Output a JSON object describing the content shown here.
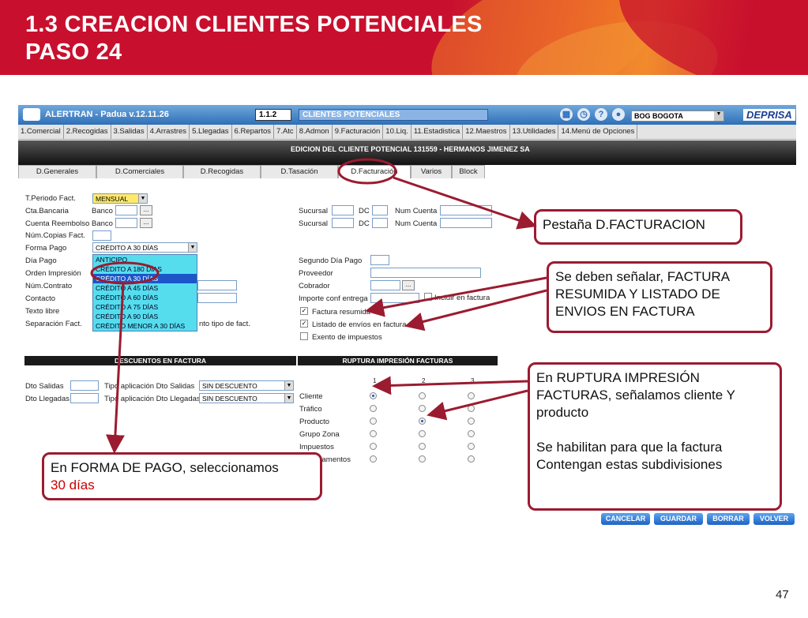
{
  "slide": {
    "title_line1": "1.3 CREACION CLIENTES POTENCIALES",
    "title_line2": "PASO 24",
    "page_number": "47"
  },
  "app": {
    "name": "ALERTRAN - Padua  v.12.11.26",
    "code": "1.1.2",
    "module": "CLIENTES POTENCIALES",
    "city": "BOG BOGOTA",
    "brand": "DEPRISA",
    "menu": [
      "1.Comercial",
      "2.Recogidas",
      "3.Salidas",
      "4.Arrastres",
      "5.Llegadas",
      "6.Repartos",
      "7.Atc",
      "8.Admon",
      "9.Facturación",
      "10.Liq.",
      "11.Estadistica",
      "12.Maestros",
      "13.Utilidades",
      "14.Menú de Opciones"
    ],
    "edit_title": "EDICION DEL CLIENTE POTENCIAL 131559 - HERMANOS JIMENEZ SA",
    "tabs": [
      "D.Generales",
      "D.Comerciales",
      "D.Recogidas",
      "D.Tasación",
      "D.Facturación",
      "Varios",
      "Block"
    ]
  },
  "form": {
    "periodo_label": "T.Periodo Fact.",
    "periodo_value": "MENSUAL",
    "cta_bancaria_label": "Cta.Bancaria",
    "cuenta_reembolso_label": "Cuenta Reembolso",
    "banco_label": "Banco",
    "copias_label": "Núm.Copias Fact.",
    "forma_pago_label": "Forma Pago",
    "forma_pago_value": "CRÉDITO A 30 DÍAS",
    "forma_pago_options": [
      "ANTICIPO",
      "CRÉDITO A 180 DÍAS",
      "CRÉDITO A 30 DÍAS",
      "CRÉDITO A 45 DÍAS",
      "CRÉDITO A 60 DÍAS",
      "CRÉDITO A 75 DÍAS",
      "CRÉDITO A 90 DÍAS",
      "CRÉDITO MENOR A 30 DÍAS"
    ],
    "dia_pago_label": "Día Pago",
    "orden_impresion_label": "Orden Impresión",
    "num_contrato_label": "Núm.Contrato",
    "contacto_label": "Contacto",
    "texto_libre_label": "Texto libre",
    "separacion_label": "Separación Fact.",
    "separacion_tail": "nto tipo de fact.",
    "sucursal_label": "Sucursal",
    "dc_label": "DC",
    "num_cuenta_label": "Num Cuenta",
    "segundo_dia_label": "Segundo Día Pago",
    "proveedor_label": "Proveedor",
    "cobrador_label": "Cobrador",
    "importe_label": "Importe conf entrega",
    "incluir_label": "Incluir en factura",
    "factura_resumida_label": "Factura resumida",
    "listado_envios_label": "Listado de envíos en factura",
    "exento_label": "Exento de impuestos",
    "descuentos_title": "DESCUENTOS EN FACTURA",
    "ruptura_title": "RUPTURA IMPRESIÓN FACTURAS",
    "dto_salidas_label": "Dto Salidas",
    "dto_llegadas_label": "Dto Llegadas",
    "tipo_salidas_label": "Tipo aplicación Dto Salidas",
    "tipo_llegadas_label": "Tipo aplicación Dto Llegadas",
    "sin_descuento": "SIN DESCUENTO",
    "ruptura_cols": [
      "1",
      "2",
      "3"
    ],
    "ruptura_rows": [
      "Cliente",
      "Tráfico",
      "Producto",
      "Grupo Zona",
      "Impuestos",
      "Departamentos"
    ],
    "buttons": {
      "cancelar": "CANCELAR",
      "guardar": "GUARDAR",
      "borrar": "BORRAR",
      "volver": "VOLVER"
    }
  },
  "callouts": {
    "pestana": "Pestaña D.FACTURACION",
    "factura_resumida": "Se deben señalar, FACTURA RESUMIDA Y LISTADO DE ENVIOS EN FACTURA",
    "ruptura_line1": "En RUPTURA IMPRESIÓN FACTURAS, señalamos cliente Y producto",
    "ruptura_line2": "Se habilitan para que la factura Contengan estas subdivisiones",
    "forma_pago_line1": "En FORMA DE PAGO, seleccionamos",
    "forma_pago_line2": "30 días"
  },
  "colors": {
    "banner_red": "#c8102e",
    "annotation": "#9b1b30",
    "app_blue": "#2e6fb8"
  }
}
